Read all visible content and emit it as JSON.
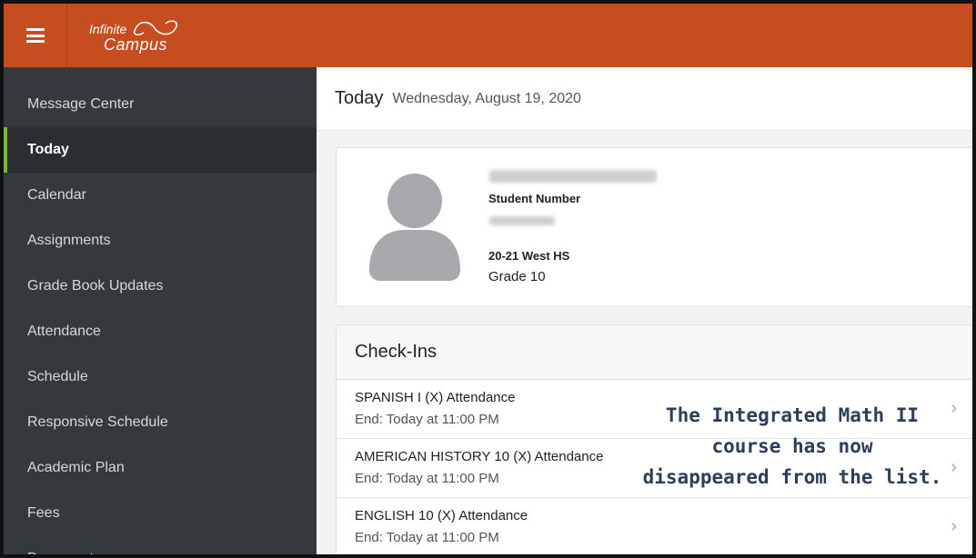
{
  "app": {
    "logo_top": "Infinite",
    "logo_bottom": "Campus"
  },
  "sidebar": {
    "items": [
      {
        "label": "Message Center"
      },
      {
        "label": "Today",
        "active": true
      },
      {
        "label": "Calendar"
      },
      {
        "label": "Assignments"
      },
      {
        "label": "Grade Book Updates"
      },
      {
        "label": "Attendance"
      },
      {
        "label": "Schedule"
      },
      {
        "label": "Responsive Schedule"
      },
      {
        "label": "Academic Plan"
      },
      {
        "label": "Fees"
      },
      {
        "label": "Documents"
      }
    ]
  },
  "header": {
    "title": "Today",
    "date": "Wednesday, August 19, 2020"
  },
  "student": {
    "number_label": "Student Number",
    "school": "20-21 West HS",
    "grade": "Grade 10"
  },
  "checkins": {
    "heading": "Check-Ins",
    "items": [
      {
        "name": "SPANISH I (X) Attendance",
        "end": "End: Today at 11:00 PM"
      },
      {
        "name": "AMERICAN HISTORY 10 (X) Attendance",
        "end": "End: Today at 11:00 PM"
      },
      {
        "name": "ENGLISH 10 (X) Attendance",
        "end": "End: Today at 11:00 PM"
      }
    ]
  },
  "annotation": {
    "line1": "The Integrated Math II",
    "line2": "course has now",
    "line3": "disappeared from the list."
  },
  "colors": {
    "topbar": "#c54d1f",
    "sidebar": "#34393d",
    "active_accent": "#7cb342",
    "annotation_text": "#2c3e5a"
  },
  "icons": {
    "menu": "hamburger-menu-icon",
    "logo": "infinity-logo-icon",
    "avatar": "user-avatar-icon",
    "chevron": "chevron-right-icon"
  }
}
